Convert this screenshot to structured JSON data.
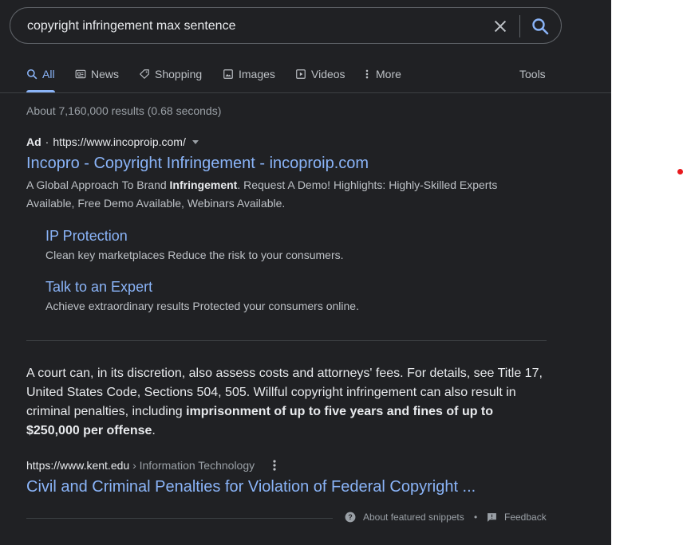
{
  "search": {
    "query": "copyright infringement max sentence"
  },
  "tabs": [
    {
      "label": "All",
      "icon": "search-icon",
      "active": true
    },
    {
      "label": "News",
      "icon": "news-icon"
    },
    {
      "label": "Shopping",
      "icon": "tag-icon"
    },
    {
      "label": "Images",
      "icon": "image-icon"
    },
    {
      "label": "Videos",
      "icon": "video-icon"
    },
    {
      "label": "More",
      "icon": "kebab-icon"
    }
  ],
  "tools_label": "Tools",
  "stats": "About 7,160,000 results (0.68 seconds)",
  "ad": {
    "label": "Ad",
    "separator": "·",
    "url": "https://www.incoproip.com/",
    "title": "Incopro - Copyright Infringement - incoproip.com",
    "desc_pre": "A Global Approach To Brand ",
    "desc_bold": "Infringement",
    "desc_post": ". Request A Demo! Highlights: Highly-Skilled Experts Available, Free Demo Available, Webinars Available.",
    "sitelinks": [
      {
        "title": "IP Protection",
        "desc": "Clean key marketplaces Reduce the risk to your consumers."
      },
      {
        "title": "Talk to an Expert",
        "desc": "Achieve extraordinary results Protected your consumers online."
      }
    ]
  },
  "snippet": {
    "text_pre": "A court can, in its discretion, also assess costs and attorneys' fees. For details, see Title 17, United States Code, Sections 504, 505. Willful copyright infringement can also result in criminal penalties, including ",
    "text_bold": "imprisonment of up to five years and fines of up to $250,000 per offense",
    "text_post": "."
  },
  "result": {
    "url": "https://www.kent.edu",
    "breadcrumb": " › Information Technology",
    "title": "Civil and Criminal Penalties for Violation of Federal Copyright ..."
  },
  "footer": {
    "about": "About featured snippets",
    "dot": "•",
    "feedback": "Feedback"
  },
  "colors": {
    "background": "#202124",
    "link": "#8ab4f8",
    "text": "#e8eaed",
    "muted": "#9aa0a6",
    "marker": "#e8191d"
  }
}
